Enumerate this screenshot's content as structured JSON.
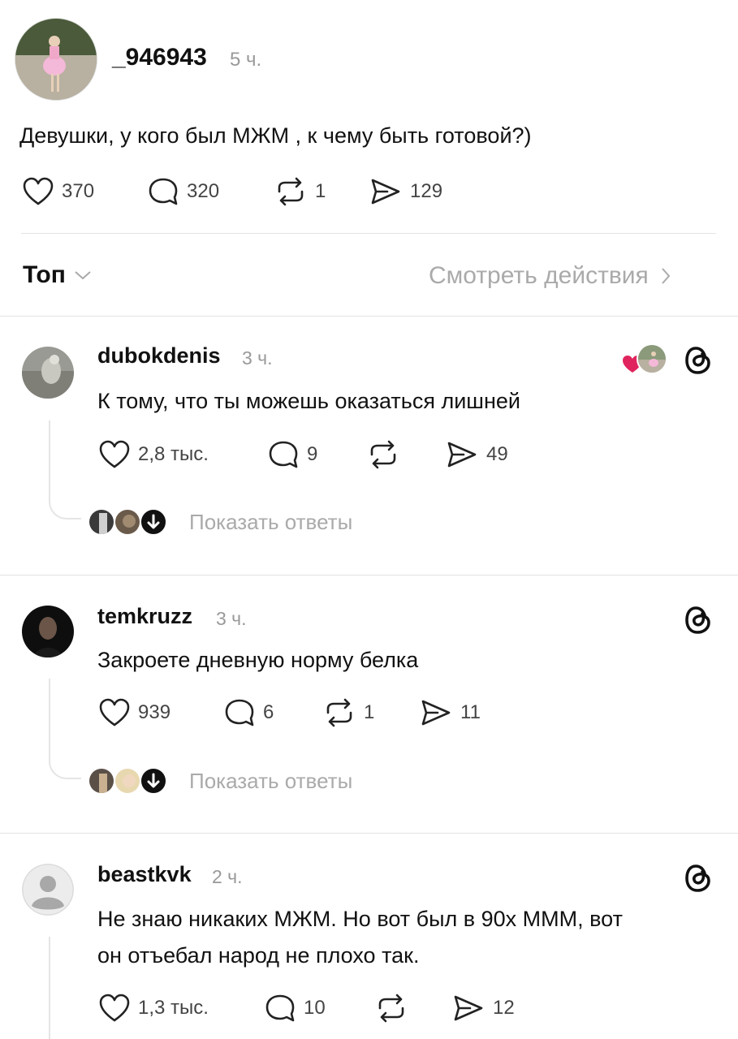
{
  "post": {
    "username": "_946943",
    "time": "5 ч.",
    "text": "Девушки, у кого был МЖМ , к чему быть готовой?)",
    "likes": "370",
    "comments": "320",
    "reposts": "1",
    "shares": "129"
  },
  "sort": {
    "label": "Топ",
    "view_activity": "Смотреть действия"
  },
  "replies": [
    {
      "username": "dubokdenis",
      "time": "3 ч.",
      "text": "К тому, что ты можешь оказаться лишней",
      "likes": "2,8 тыс.",
      "comments": "9",
      "reposts": "",
      "shares": "49",
      "show_replies": "Показать ответы"
    },
    {
      "username": "temkruzz",
      "time": "3 ч.",
      "text": "Закроете дневную норму белка",
      "likes": "939",
      "comments": "6",
      "reposts": "1",
      "shares": "11",
      "show_replies": "Показать ответы"
    },
    {
      "username": "beastkvk",
      "time": "2 ч.",
      "text_line1": "Не знаю никаких МЖМ. Но вот был в 90х МММ, вот",
      "text_line2": "он отъебал народ не плохо так.",
      "likes": "1,3 тыс.",
      "comments": "10",
      "reposts": "",
      "shares": "12"
    }
  ],
  "colors": {
    "heart_red": "#e0245e",
    "muted_gray": "#999999",
    "divider": "#e3e3e3"
  },
  "icons": [
    "heart-icon",
    "comment-icon",
    "repost-icon",
    "share-icon",
    "threads-icon",
    "chevron-down-icon",
    "chevron-right-icon",
    "down-arrow-icon"
  ]
}
